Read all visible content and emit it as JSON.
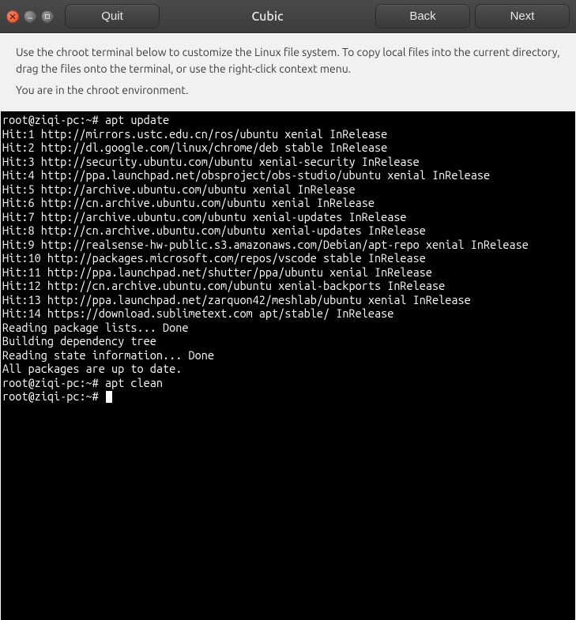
{
  "window": {
    "title": "Cubic",
    "buttons": {
      "quit": "Quit",
      "back": "Back",
      "next": "Next"
    }
  },
  "info": {
    "line1": "Use the chroot terminal below to customize the Linux file system. To copy local files into the current directory, drag the files onto the terminal, or use the right-click context menu.",
    "line2": "You are in the chroot environment."
  },
  "terminal": {
    "prompt": "root@ziqi-pc:~#",
    "lines": [
      "root@ziqi-pc:~# apt update",
      "Hit:1 http://mirrors.ustc.edu.cn/ros/ubuntu xenial InRelease",
      "Hit:2 http://dl.google.com/linux/chrome/deb stable InRelease",
      "Hit:3 http://security.ubuntu.com/ubuntu xenial-security InRelease",
      "Hit:4 http://ppa.launchpad.net/obsproject/obs-studio/ubuntu xenial InRelease",
      "Hit:5 http://archive.ubuntu.com/ubuntu xenial InRelease",
      "Hit:6 http://cn.archive.ubuntu.com/ubuntu xenial InRelease",
      "Hit:7 http://archive.ubuntu.com/ubuntu xenial-updates InRelease",
      "Hit:8 http://cn.archive.ubuntu.com/ubuntu xenial-updates InRelease",
      "Hit:9 http://realsense-hw-public.s3.amazonaws.com/Debian/apt-repo xenial InRelease",
      "Hit:10 http://packages.microsoft.com/repos/vscode stable InRelease",
      "Hit:11 http://ppa.launchpad.net/shutter/ppa/ubuntu xenial InRelease",
      "Hit:12 http://cn.archive.ubuntu.com/ubuntu xenial-backports InRelease",
      "Hit:13 http://ppa.launchpad.net/zarquon42/meshlab/ubuntu xenial InRelease",
      "Hit:14 https://download.sublimetext.com apt/stable/ InRelease",
      "Reading package lists... Done",
      "Building dependency tree",
      "Reading state information... Done",
      "All packages are up to date.",
      "root@ziqi-pc:~# apt clean",
      "root@ziqi-pc:~# "
    ]
  }
}
